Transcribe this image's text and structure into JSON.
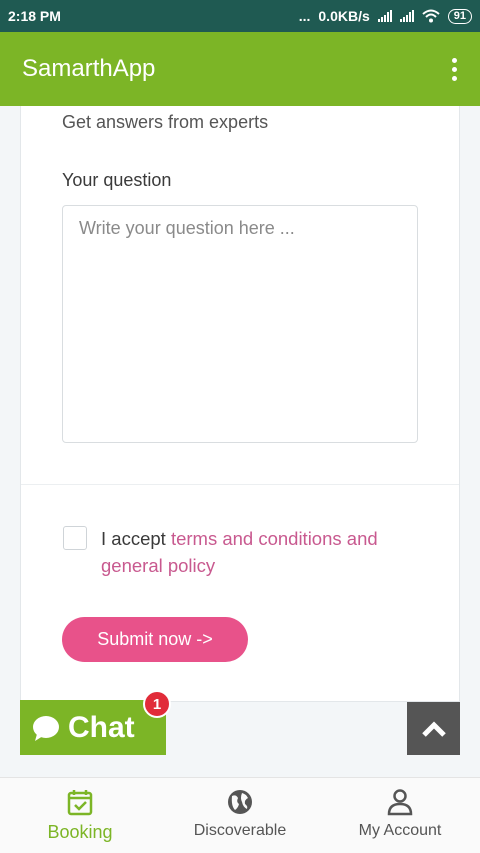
{
  "status_bar": {
    "time": "2:18 PM",
    "dots": "...",
    "speed": "0.0KB/s",
    "battery": "91"
  },
  "app_bar": {
    "title": "SamarthApp"
  },
  "form": {
    "subtitle": "Get answers from experts",
    "question_label": "Your question",
    "question_placeholder": "Write your question here ...",
    "accept_prefix": "I accept ",
    "accept_link": "terms and conditions and general policy",
    "submit_label": "Submit now ->"
  },
  "chat": {
    "label": "Chat",
    "badge": "1"
  },
  "bottom_nav": {
    "items": [
      {
        "label": "Booking",
        "icon": "calendar-check-icon",
        "active": true
      },
      {
        "label": "Discoverable",
        "icon": "globe-icon",
        "active": false
      },
      {
        "label": "My Account",
        "icon": "person-icon",
        "active": false
      }
    ]
  },
  "colors": {
    "primary": "#7cb526",
    "accent": "#e8528a",
    "status_bar": "#1f5a52",
    "badge": "#e12c39"
  }
}
